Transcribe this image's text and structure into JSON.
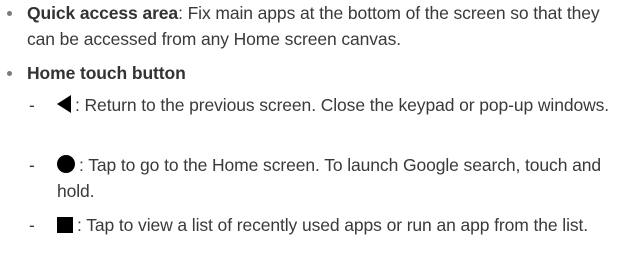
{
  "items": [
    {
      "term": "Quick access area",
      "text": ": Fix main apps at the bottom of the screen so that they can be accessed from any Home screen canvas."
    },
    {
      "term": "Home touch button",
      "subitems": [
        {
          "icon": "back-triangle-icon",
          "text": ": Return to the previous screen. Close the keypad or pop-up windows."
        },
        {
          "icon": "home-circle-icon",
          "text": ": Tap to go to the Home screen. To launch Google search, touch and hold."
        },
        {
          "icon": "recent-apps-square-icon",
          "text": ": Tap to view a list of recently used apps or run an app from the list."
        }
      ]
    }
  ],
  "dash": "-"
}
